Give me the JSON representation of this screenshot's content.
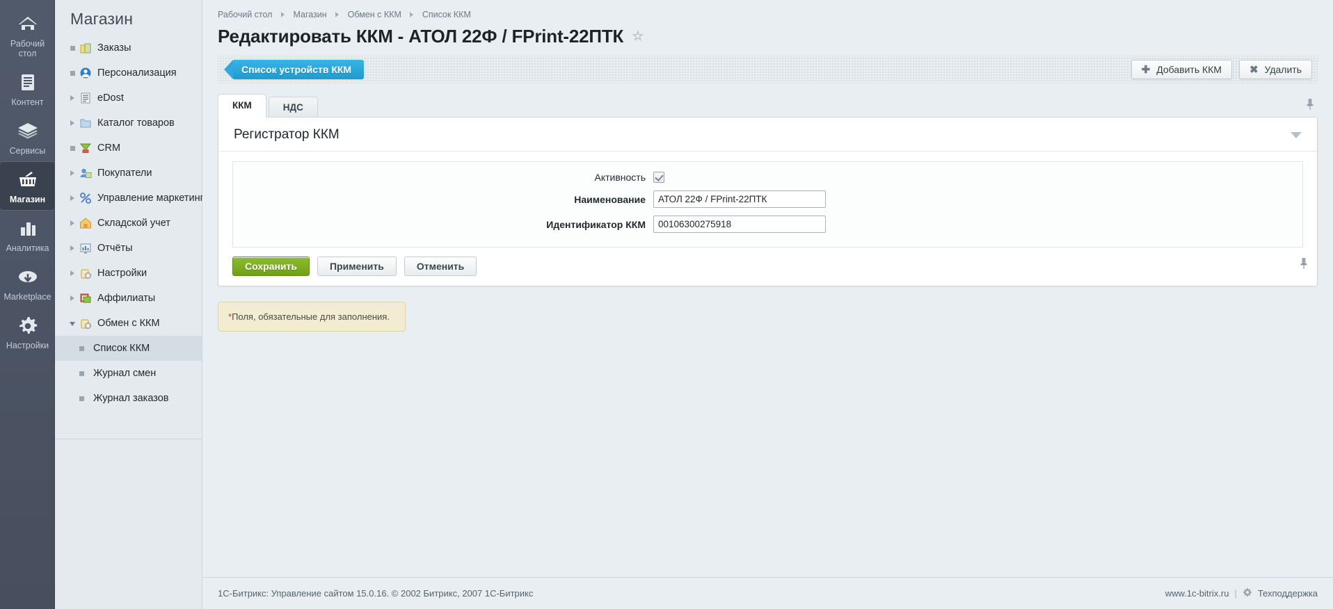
{
  "rail": {
    "items": [
      {
        "label_line1": "Рабочий",
        "label_line2": "стол",
        "icon": "home-icon",
        "active": false
      },
      {
        "label_line1": "Контент",
        "label_line2": "",
        "icon": "document-icon",
        "active": false
      },
      {
        "label_line1": "Сервисы",
        "label_line2": "",
        "icon": "layers-icon",
        "active": false
      },
      {
        "label_line1": "Магазин",
        "label_line2": "",
        "icon": "basket-icon",
        "active": true
      },
      {
        "label_line1": "Аналитика",
        "label_line2": "",
        "icon": "bar-chart-icon",
        "active": false
      },
      {
        "label_line1": "Marketplace",
        "label_line2": "",
        "icon": "cloud-download-icon",
        "active": false
      },
      {
        "label_line1": "Настройки",
        "label_line2": "",
        "icon": "gear-icon",
        "active": false
      }
    ]
  },
  "sidebar": {
    "title": "Магазин",
    "items": [
      {
        "label": "Заказы",
        "twist": "dot",
        "icon": "bag-icon"
      },
      {
        "label": "Персонализация",
        "twist": "dot",
        "icon": "user-circle-icon"
      },
      {
        "label": "eDost",
        "twist": "arrow",
        "icon": "list-doc-icon"
      },
      {
        "label": "Каталог товаров",
        "twist": "arrow",
        "icon": "folder-icon"
      },
      {
        "label": "CRM",
        "twist": "dot",
        "icon": "funnel-icon"
      },
      {
        "label": "Покупатели",
        "twist": "arrow",
        "icon": "users-icon"
      },
      {
        "label": "Управление маркетингом",
        "twist": "arrow",
        "icon": "percent-icon"
      },
      {
        "label": "Складской учет",
        "twist": "arrow",
        "icon": "warehouse-icon"
      },
      {
        "label": "Отчёты",
        "twist": "arrow",
        "icon": "report-icon"
      },
      {
        "label": "Настройки",
        "twist": "arrow",
        "icon": "settings-bag-icon"
      },
      {
        "label": "Аффилиаты",
        "twist": "arrow",
        "icon": "affiliate-icon"
      },
      {
        "label": "Обмен с ККМ",
        "twist": "open",
        "icon": "settings-bag-icon"
      }
    ],
    "subitems": [
      {
        "label": "Список ККМ",
        "selected": true
      },
      {
        "label": "Журнал смен",
        "selected": false
      },
      {
        "label": "Журнал заказов",
        "selected": false
      }
    ]
  },
  "breadcrumb": [
    "Рабочий стол",
    "Магазин",
    "Обмен с ККМ",
    "Список ККМ"
  ],
  "page": {
    "title": "Редактировать ККМ - АТОЛ 22Ф / FPrint-22ПТК",
    "favorite_icon": "star-icon"
  },
  "toolbar": {
    "flag_label": "Список устройств ККМ",
    "add_label": "Добавить ККМ",
    "add_icon": "plus-icon",
    "delete_label": "Удалить",
    "delete_icon": "cross-icon"
  },
  "tabs": [
    {
      "label": "ККМ",
      "active": true
    },
    {
      "label": "НДС",
      "active": false
    }
  ],
  "pin_icon": "pin-icon",
  "panel": {
    "heading": "Регистратор ККМ",
    "collapse_icon": "chevron-down-icon",
    "fields": [
      {
        "label": "Активность",
        "type": "checkbox",
        "checked": true,
        "bold": false
      },
      {
        "label": "Наименование",
        "type": "text",
        "value": "АТОЛ 22Ф / FPrint-22ПТК",
        "placeholder": "",
        "bold": true
      },
      {
        "label": "Идентификатор ККМ",
        "type": "text",
        "value": "00106300275918",
        "placeholder": "",
        "bold": true
      }
    ],
    "buttons": [
      {
        "label": "Сохранить",
        "style": "primary"
      },
      {
        "label": "Применить",
        "style": "default"
      },
      {
        "label": "Отменить",
        "style": "default"
      }
    ]
  },
  "note": {
    "asterisk": "*",
    "text": "Поля, обязательные для заполнения."
  },
  "footer": {
    "copyright": "1С-Битрикс: Управление сайтом 15.0.16. © 2002 Битрикс, 2007 1С-Битрикс",
    "site": "www.1c-bitrix.ru",
    "separator": "|",
    "support": "Техподдержка",
    "support_icon": "gear-icon"
  },
  "colors": {
    "accent_blue": "#2fa9dd",
    "primary_green": "#7aac20",
    "rail_bg": "#4b5464",
    "menu_bg": "#e4eaed",
    "content_bg": "#e8eef1"
  }
}
